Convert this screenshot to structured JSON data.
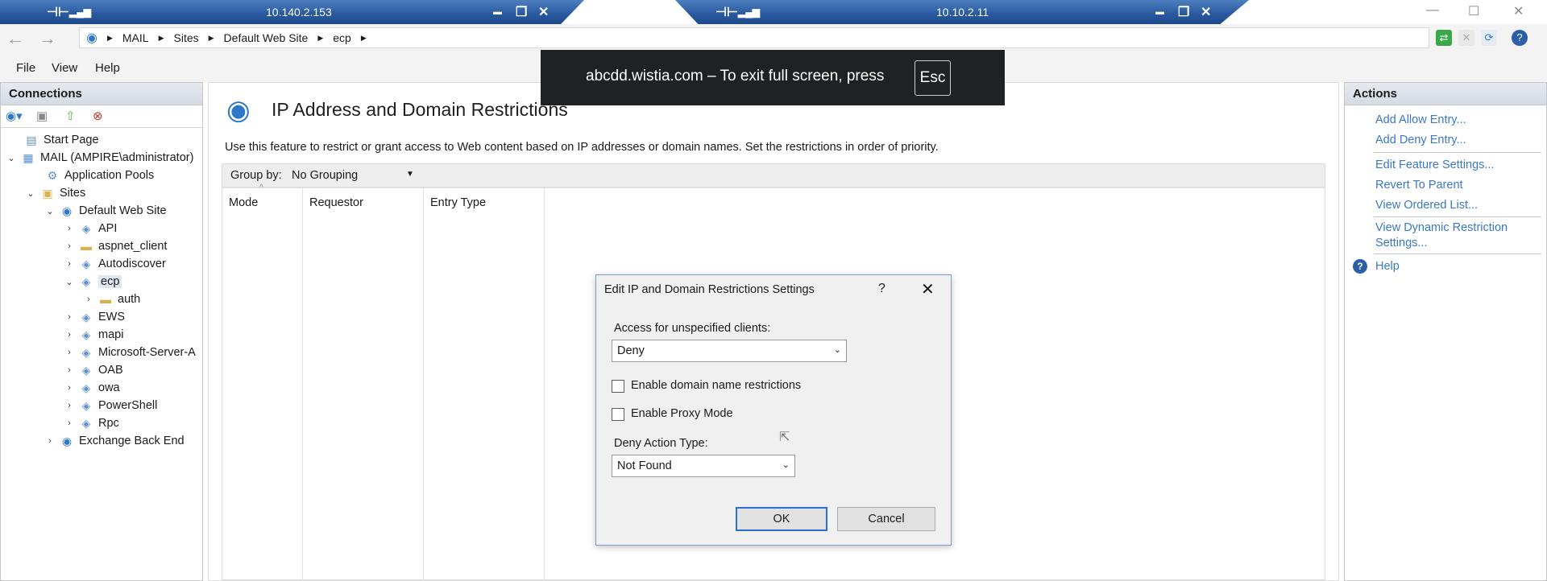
{
  "remote_bar_1": {
    "ip": "10.140.2.153",
    "ctl_pin": "⊣⊢",
    "ctl_signal": "▂▄▆",
    "ctl_min": "▬",
    "ctl_restore": "❐",
    "ctl_close": "✕"
  },
  "remote_bar_2": {
    "ip": "10.10.2.11",
    "ctl_pin": "⊣⊢",
    "ctl_signal": "▂▄▆",
    "ctl_min": "▬",
    "ctl_restore": "❐",
    "ctl_close": "✕"
  },
  "window_controls": {
    "minimize": "—",
    "maximize": "☐",
    "close": "✕"
  },
  "address": {
    "back": "←",
    "forward": "→",
    "crumbs": [
      "MAIL",
      "Sites",
      "Default Web Site",
      "ecp"
    ]
  },
  "menu": {
    "file": "File",
    "view": "View",
    "help": "Help"
  },
  "connections": {
    "title": "Connections",
    "tree": {
      "start_page": "Start Page",
      "server": "MAIL (AMPIRE\\administrator)",
      "app_pools": "Application Pools",
      "sites": "Sites",
      "default_site": "Default Web Site",
      "api": "API",
      "aspnet_client": "aspnet_client",
      "autodiscover": "Autodiscover",
      "ecp": "ecp",
      "auth": "auth",
      "ews": "EWS",
      "mapi": "mapi",
      "microsoft_server": "Microsoft-Server-A",
      "oab": "OAB",
      "owa": "owa",
      "powershell": "PowerShell",
      "rpc": "Rpc",
      "exchange_back_end": "Exchange Back End"
    }
  },
  "main": {
    "title": "IP Address and Domain Restrictions",
    "description": "Use this feature to restrict or grant access to Web content based on IP addresses or domain names. Set the restrictions in order of priority.",
    "group_by_label": "Group by:",
    "group_by_value": "No Grouping",
    "columns": [
      "Mode",
      "Requestor",
      "Entry Type"
    ]
  },
  "actions": {
    "title": "Actions",
    "add_allow": "Add Allow Entry...",
    "add_deny": "Add Deny Entry...",
    "edit_feature": "Edit Feature Settings...",
    "revert": "Revert To Parent",
    "view_ordered": "View Ordered List...",
    "view_dynamic_1": "View Dynamic Restriction",
    "view_dynamic_2": "Settings...",
    "help": "Help"
  },
  "fullscreen_banner": {
    "text": "abcdd.wistia.com – To exit full screen, press",
    "key": "Esc"
  },
  "dialog": {
    "title": "Edit IP and Domain Restrictions Settings",
    "help": "?",
    "close": "✕",
    "access_label": "Access for unspecified clients:",
    "access_value": "Deny",
    "domain_restrictions_label": "Enable domain name restrictions",
    "domain_restrictions_checked": false,
    "proxy_mode_label": "Enable Proxy Mode",
    "proxy_mode_checked": false,
    "deny_action_label": "Deny Action Type:",
    "deny_action_value": "Not Found",
    "ok": "OK",
    "cancel": "Cancel"
  },
  "colors": {
    "accent": "#2b5aa0",
    "link": "#3a78c4",
    "banner": "#202124"
  }
}
